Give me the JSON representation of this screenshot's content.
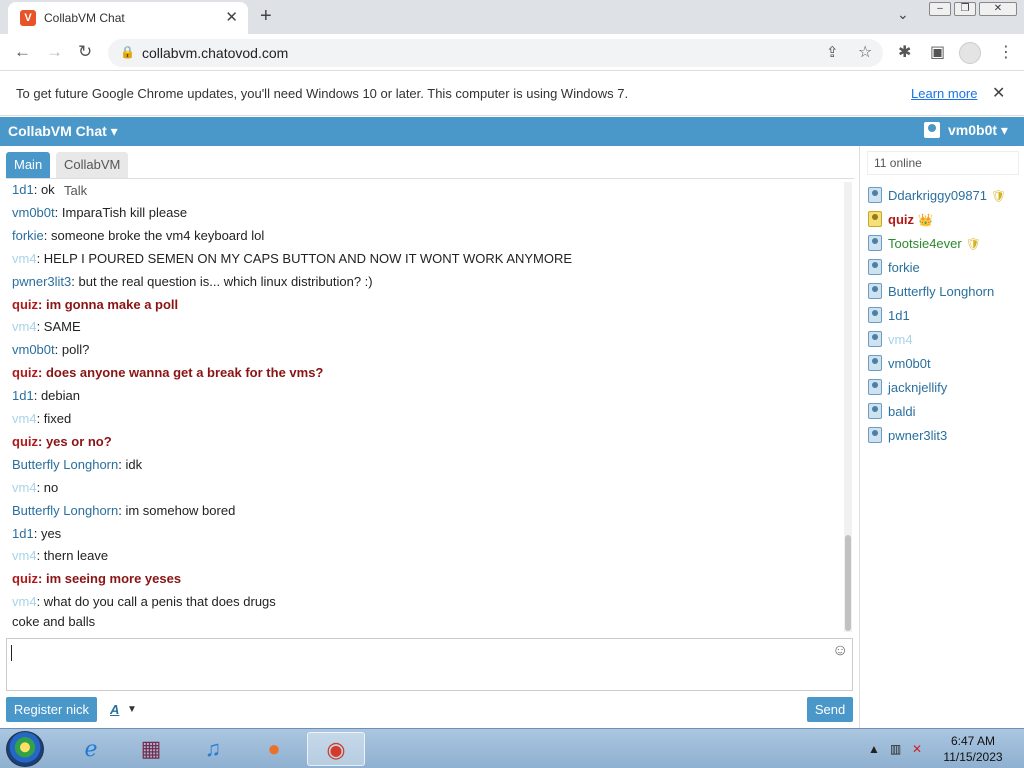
{
  "browser": {
    "tab_title": "CollabVM Chat",
    "tab_close": "✕",
    "new_tab": "+",
    "url": "collabvm.chatovod.com"
  },
  "infobar": {
    "message": "To get future Google Chrome updates, you'll need Windows 10 or later. This computer is using Windows 7.",
    "learn_more": "Learn more",
    "close": "✕"
  },
  "app": {
    "brand": "CollabVM Chat ▾",
    "current_user": "vm0b0t ▾"
  },
  "channels": [
    {
      "label": "Main"
    },
    {
      "label": "CollabVM Talk"
    }
  ],
  "messages": [
    {
      "nick": "1d1",
      "text": "ok",
      "role": "user"
    },
    {
      "nick": "vm0b0t",
      "text": "ImparaTish kill please",
      "role": "user"
    },
    {
      "nick": "forkie",
      "text": "someone broke the vm4 keyboard lol",
      "role": "user"
    },
    {
      "nick": "vm4",
      "text": "HELP I POURED SEMEN ON MY CAPS BUTTON AND NOW IT WONT WORK ANYMORE",
      "role": "guest"
    },
    {
      "nick": "pwner3lit3",
      "text": "but the real question is... which linux distribution? :)",
      "role": "user"
    },
    {
      "nick": "quiz",
      "text": "im gonna make a poll",
      "role": "admin"
    },
    {
      "nick": "vm4",
      "text": "SAME",
      "role": "guest"
    },
    {
      "nick": "vm0b0t",
      "text": "poll?",
      "role": "user"
    },
    {
      "nick": "quiz",
      "text": "does anyone wanna get a break for the vms?",
      "role": "admin"
    },
    {
      "nick": "1d1",
      "text": "debian",
      "role": "user"
    },
    {
      "nick": "vm4",
      "text": "fixed",
      "role": "guest"
    },
    {
      "nick": "quiz",
      "text": "yes or no?",
      "role": "admin"
    },
    {
      "nick": "Butterfly Longhorn",
      "text": "idk",
      "role": "user"
    },
    {
      "nick": "vm4",
      "text": "no",
      "role": "guest"
    },
    {
      "nick": "Butterfly Longhorn",
      "text": "im somehow bored",
      "role": "user"
    },
    {
      "nick": "1d1",
      "text": "yes",
      "role": "user"
    },
    {
      "nick": "vm4",
      "text": "thern leave",
      "role": "guest"
    },
    {
      "nick": "quiz",
      "text": "im seeing more yeses",
      "role": "admin"
    },
    {
      "nick": "vm4",
      "text": "what do you call a penis that does drugs",
      "role": "guest"
    }
  ],
  "continuation": "coke and balls",
  "composer": {
    "register_label": "Register nick",
    "font_label": "A",
    "send_label": "Send",
    "emoji": "☺"
  },
  "sidebar": {
    "online_count": "11 online",
    "users": [
      {
        "name": "Ddarkriggy09871",
        "role": "mod-badge",
        "badge": "🛡"
      },
      {
        "name": "quiz",
        "role": "admin",
        "badge": "👑"
      },
      {
        "name": "Tootsie4ever",
        "role": "mod",
        "badge": "🛡"
      },
      {
        "name": "forkie",
        "role": "user",
        "badge": ""
      },
      {
        "name": "Butterfly Longhorn",
        "role": "user",
        "badge": ""
      },
      {
        "name": "1d1",
        "role": "user",
        "badge": ""
      },
      {
        "name": "vm4",
        "role": "guest",
        "badge": ""
      },
      {
        "name": "vm0b0t",
        "role": "user",
        "badge": ""
      },
      {
        "name": "jacknjellify",
        "role": "user",
        "badge": ""
      },
      {
        "name": "baldi",
        "role": "user",
        "badge": ""
      },
      {
        "name": "pwner3lit3",
        "role": "user",
        "badge": ""
      }
    ]
  },
  "taskbar": {
    "time": "6:47 AM",
    "date": "11/15/2023",
    "apps": [
      "internet-explorer",
      "winrar",
      "itunes",
      "firefox",
      "chrome"
    ]
  },
  "colors": {
    "accent": "#4a97c9",
    "admin": "#b0191a",
    "mod": "#2b8a2b",
    "guest": "#a8d4e6"
  }
}
